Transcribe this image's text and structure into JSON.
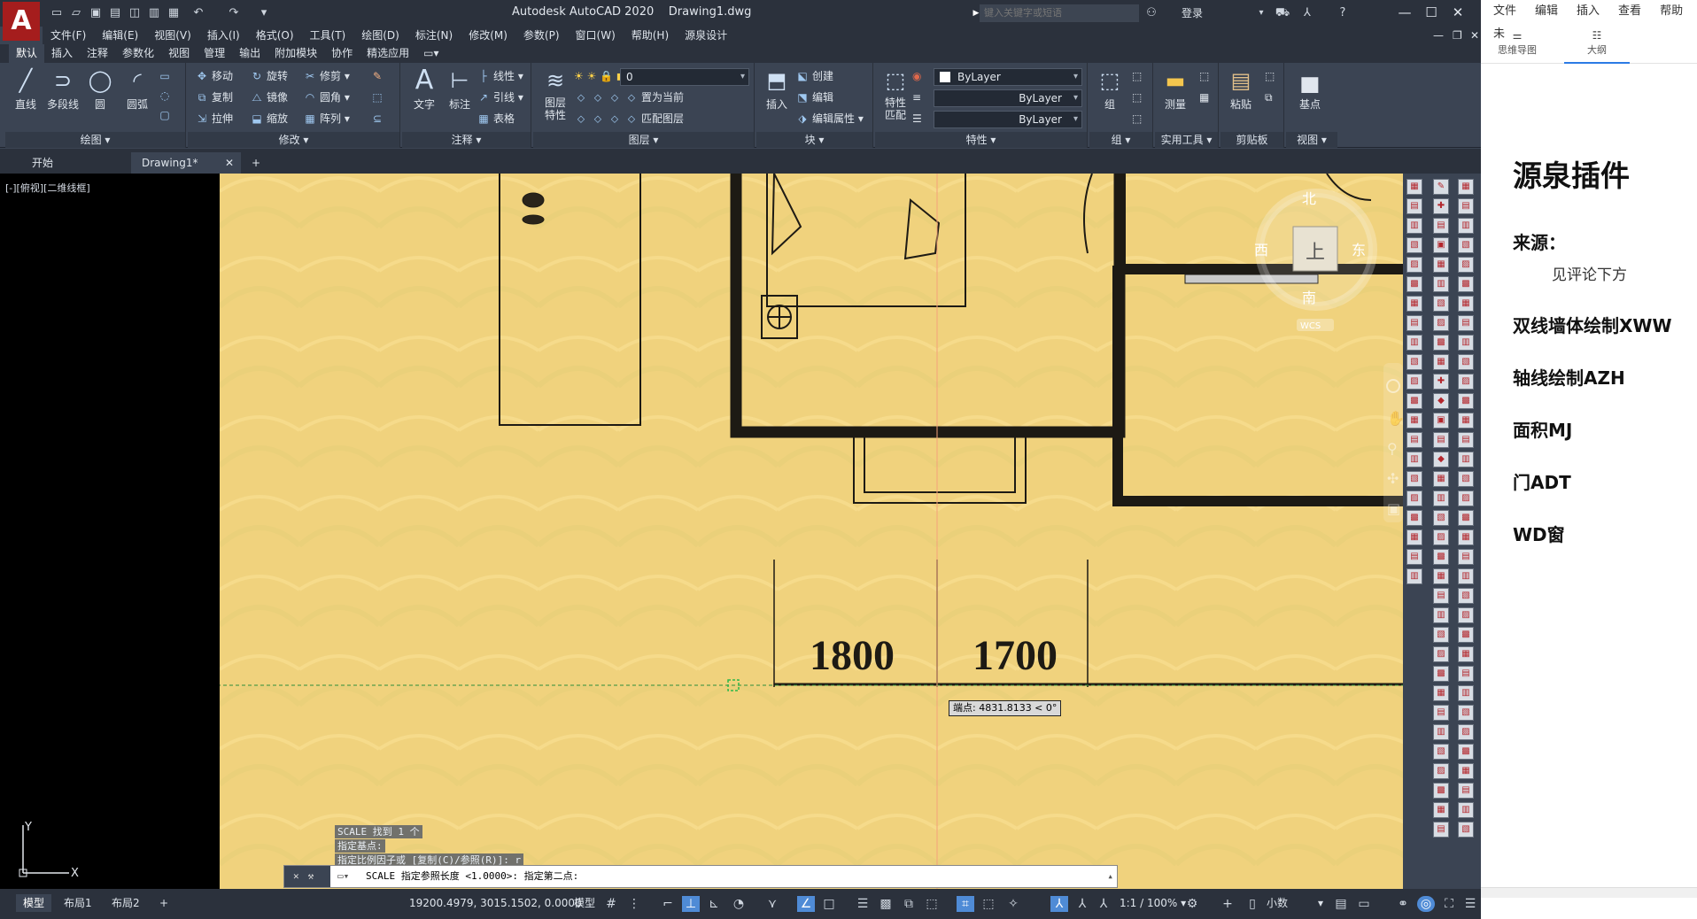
{
  "app": {
    "logo_letter": "A",
    "title": "Autodesk AutoCAD 2020",
    "file": "Drawing1.dwg",
    "search_placeholder": "键入关键字或短语",
    "login": "登录"
  },
  "menu": [
    "文件(F)",
    "编辑(E)",
    "视图(V)",
    "插入(I)",
    "格式(O)",
    "工具(T)",
    "绘图(D)",
    "标注(N)",
    "修改(M)",
    "参数(P)",
    "窗口(W)",
    "帮助(H)",
    "源泉设计"
  ],
  "ribbon_tabs": [
    "默认",
    "插入",
    "注释",
    "参数化",
    "视图",
    "管理",
    "输出",
    "附加模块",
    "协作",
    "精选应用"
  ],
  "ribbon": {
    "draw": {
      "title": "绘图",
      "line": "直线",
      "polyline": "多段线",
      "circle": "圆",
      "arc": "圆弧"
    },
    "modify": {
      "title": "修改",
      "move": "移动",
      "rotate": "旋转",
      "trim": "修剪",
      "copy": "复制",
      "mirror": "镜像",
      "fillet": "圆角",
      "stretch": "拉伸",
      "scale": "缩放",
      "array": "阵列"
    },
    "annotate": {
      "title": "注释",
      "text": "文字",
      "dim": "标注",
      "linear": "线性",
      "leader": "引线",
      "table": "表格"
    },
    "layers": {
      "title": "图层",
      "props": "图层特性",
      "layer_value": "0",
      "set_current": "置为当前",
      "match": "匹配图层"
    },
    "block": {
      "title": "块",
      "insert": "插入",
      "create": "创建",
      "edit": "编辑",
      "edit_attr": "编辑属性"
    },
    "properties": {
      "title": "特性",
      "match": "特性匹配",
      "bylayer1": "ByLayer",
      "bylayer2": "ByLayer",
      "bylayer3": "ByLayer"
    },
    "groups": {
      "title": "组",
      "group": "组"
    },
    "utilities": {
      "title": "实用工具",
      "measure": "测量"
    },
    "clipboard": {
      "title": "剪贴板",
      "paste": "粘贴"
    },
    "view": {
      "title": "视图",
      "base": "基点"
    }
  },
  "doc_tabs": {
    "start": "开始",
    "drawing": "Drawing1*",
    "add": "+"
  },
  "viewport_label": "[-][俯视][二维线框]",
  "viewcube": {
    "north": "北",
    "south": "南",
    "east": "东",
    "west": "西",
    "top": "上",
    "wcs": "WCS"
  },
  "dimensions": [
    "1800",
    "1700"
  ],
  "coord_tooltip": "端点: 4831.8133 < 0°",
  "command_history": [
    "SCALE 找到 1 个",
    "指定基点:",
    "指定比例因子或 [复制(C)/参照(R)]: r"
  ],
  "command_prompt": "SCALE 指定参照长度 <1.0000>:  指定第二点:",
  "status": {
    "tabs": [
      "模型",
      "布局1",
      "布局2"
    ],
    "coords": "19200.4979, 3015.1502, 0.0000",
    "model": "模型",
    "scale": "1:1 / 100%",
    "units": "小数"
  },
  "mindmap": {
    "menu": [
      "文件",
      "编辑",
      "插入",
      "查看",
      "帮助",
      "未"
    ],
    "tabs": [
      "思维导图",
      "大纲"
    ],
    "title": "源泉插件",
    "source_label": "来源：",
    "source_note": "见评论下方",
    "items": [
      "双线墙体绘制XWW",
      "轴线绘制AZH",
      "面积MJ",
      "门ADT",
      "WD窗"
    ]
  }
}
